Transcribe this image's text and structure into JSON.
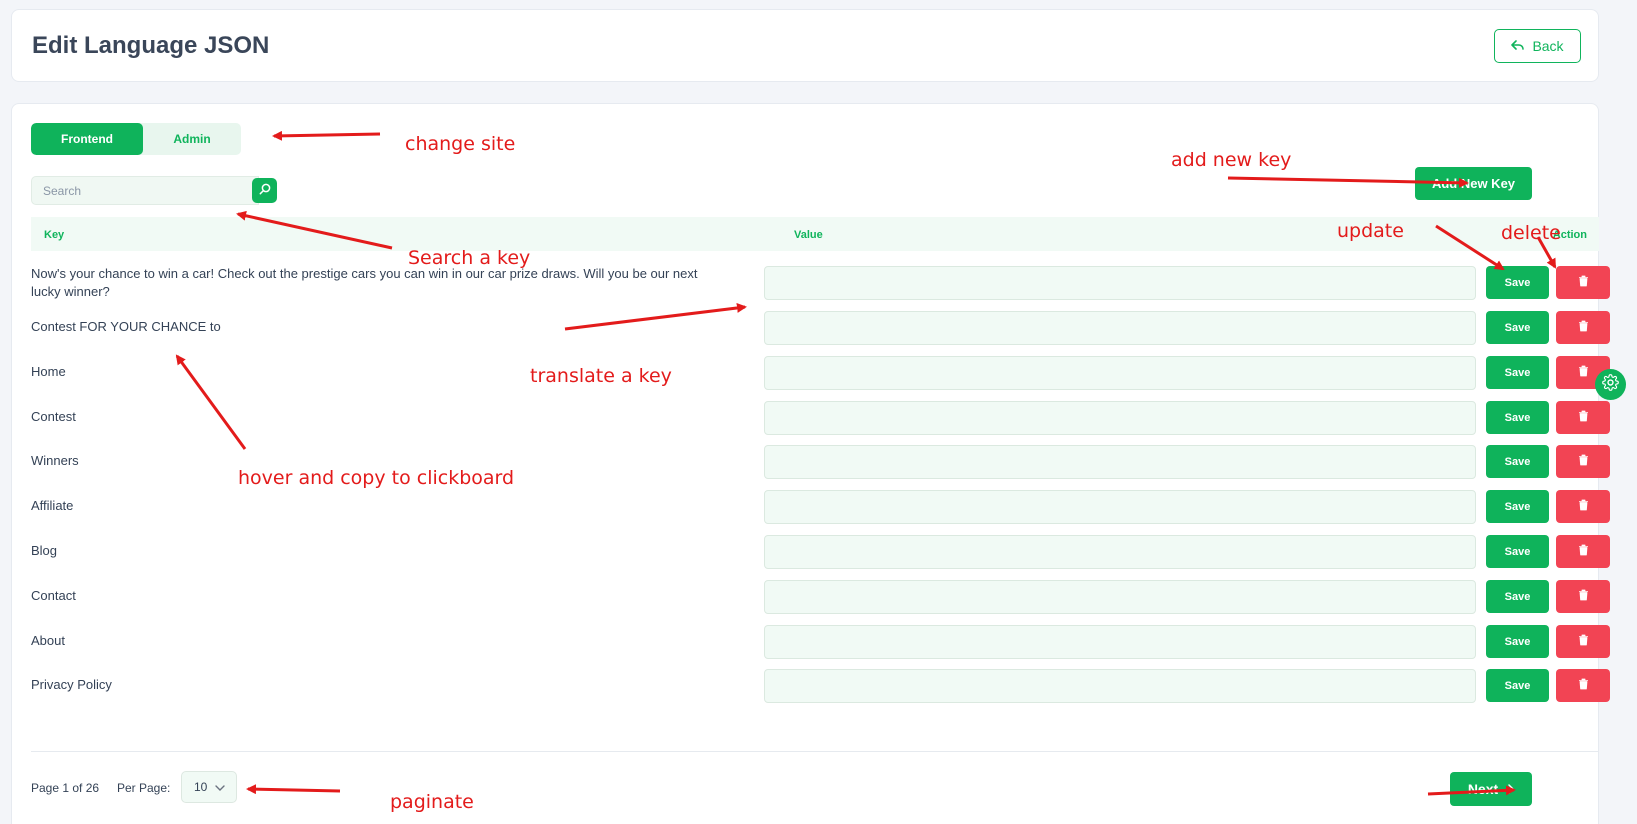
{
  "header": {
    "title": "Edit Language JSON",
    "back_label": "Back"
  },
  "tabs": [
    {
      "label": "Frontend",
      "active": true
    },
    {
      "label": "Admin",
      "active": false
    }
  ],
  "search": {
    "placeholder": "Search",
    "value": ""
  },
  "add_new_key_label": "Add New Key",
  "table": {
    "columns": {
      "key": "Key",
      "value": "Value",
      "action": "Action"
    },
    "save_label": "Save",
    "rows": [
      {
        "key": "Now's your chance to win a car! Check out the prestige cars you can win in our car prize draws. Will you be our next lucky winner?",
        "value": ""
      },
      {
        "key": "Contest FOR YOUR CHANCE to",
        "value": ""
      },
      {
        "key": "Home",
        "value": ""
      },
      {
        "key": "Contest",
        "value": ""
      },
      {
        "key": "Winners",
        "value": ""
      },
      {
        "key": "Affiliate",
        "value": ""
      },
      {
        "key": "Blog",
        "value": ""
      },
      {
        "key": "Contact",
        "value": ""
      },
      {
        "key": "About",
        "value": ""
      },
      {
        "key": "Privacy Policy",
        "value": ""
      }
    ]
  },
  "pagination": {
    "page_info": "Page 1 of 26",
    "per_page_label": "Per Page:",
    "per_page_value": "10",
    "next_label": "Next"
  },
  "annotations": {
    "change_site": "change site",
    "add_new_key": "add new key",
    "update": "update",
    "delete": "delete",
    "search_a_key": "Search a key",
    "translate_a_key": "translate a key",
    "hover_copy": "hover and copy to clickboard",
    "paginate": "paginate"
  },
  "colors": {
    "accent": "#0fb35b",
    "danger": "#f24454",
    "annotation": "#e31b1b"
  }
}
